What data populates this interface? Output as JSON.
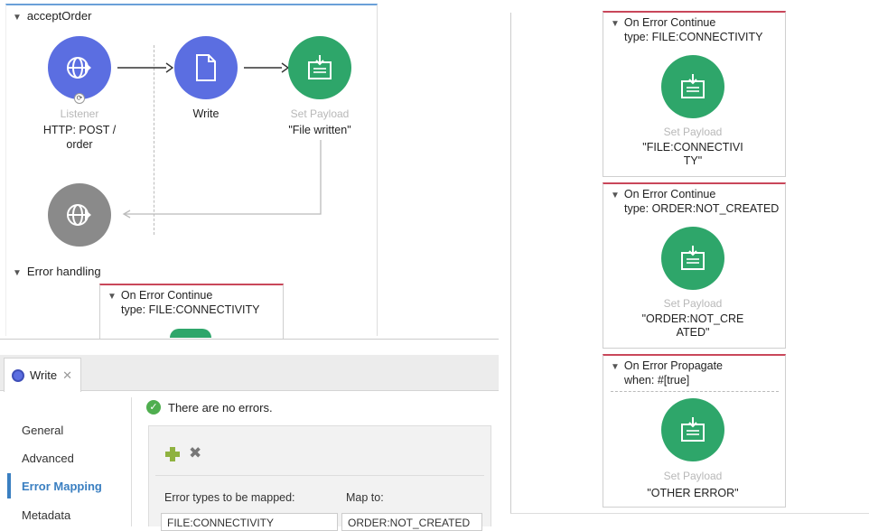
{
  "flow": {
    "title": "acceptOrder",
    "listener": {
      "type": "Listener",
      "label": "HTTP: POST /\norder"
    },
    "write": {
      "label": "Write"
    },
    "set_payload": {
      "type": "Set Payload",
      "label": "\"File written\""
    },
    "error_handling_title": "Error handling",
    "inline_handler": {
      "title": "On Error Continue",
      "type": "type: FILE:CONNECTIVITY"
    }
  },
  "handlers": [
    {
      "title": "On Error Continue",
      "condition": "type: FILE:CONNECTIVITY",
      "component_type": "Set Payload",
      "payload": "\"FILE:CONNECTIVI\nTY\""
    },
    {
      "title": "On Error Continue",
      "condition": "type: ORDER:NOT_CREATED",
      "component_type": "Set Payload",
      "payload": "\"ORDER:NOT_CRE\nATED\""
    },
    {
      "title": "On Error Propagate",
      "condition": "when: #[true]",
      "component_type": "Set Payload",
      "payload": "\"OTHER ERROR\""
    }
  ],
  "editor": {
    "tab_label": "Write",
    "status": "There are no errors.",
    "nav": [
      "General",
      "Advanced",
      "Error Mapping",
      "Metadata"
    ],
    "active_nav": "Error Mapping",
    "col_error_types": "Error types to be mapped:",
    "col_map_to": "Map to:",
    "row_error_type": "FILE:CONNECTIVITY",
    "row_map_to": "ORDER:NOT_CREATED"
  },
  "colors": {
    "blue": "#5b6ee1",
    "green": "#2ea66a",
    "grey": "#8a8a8a",
    "accent_red": "#c9475a",
    "nav_active": "#3a7fc1"
  }
}
